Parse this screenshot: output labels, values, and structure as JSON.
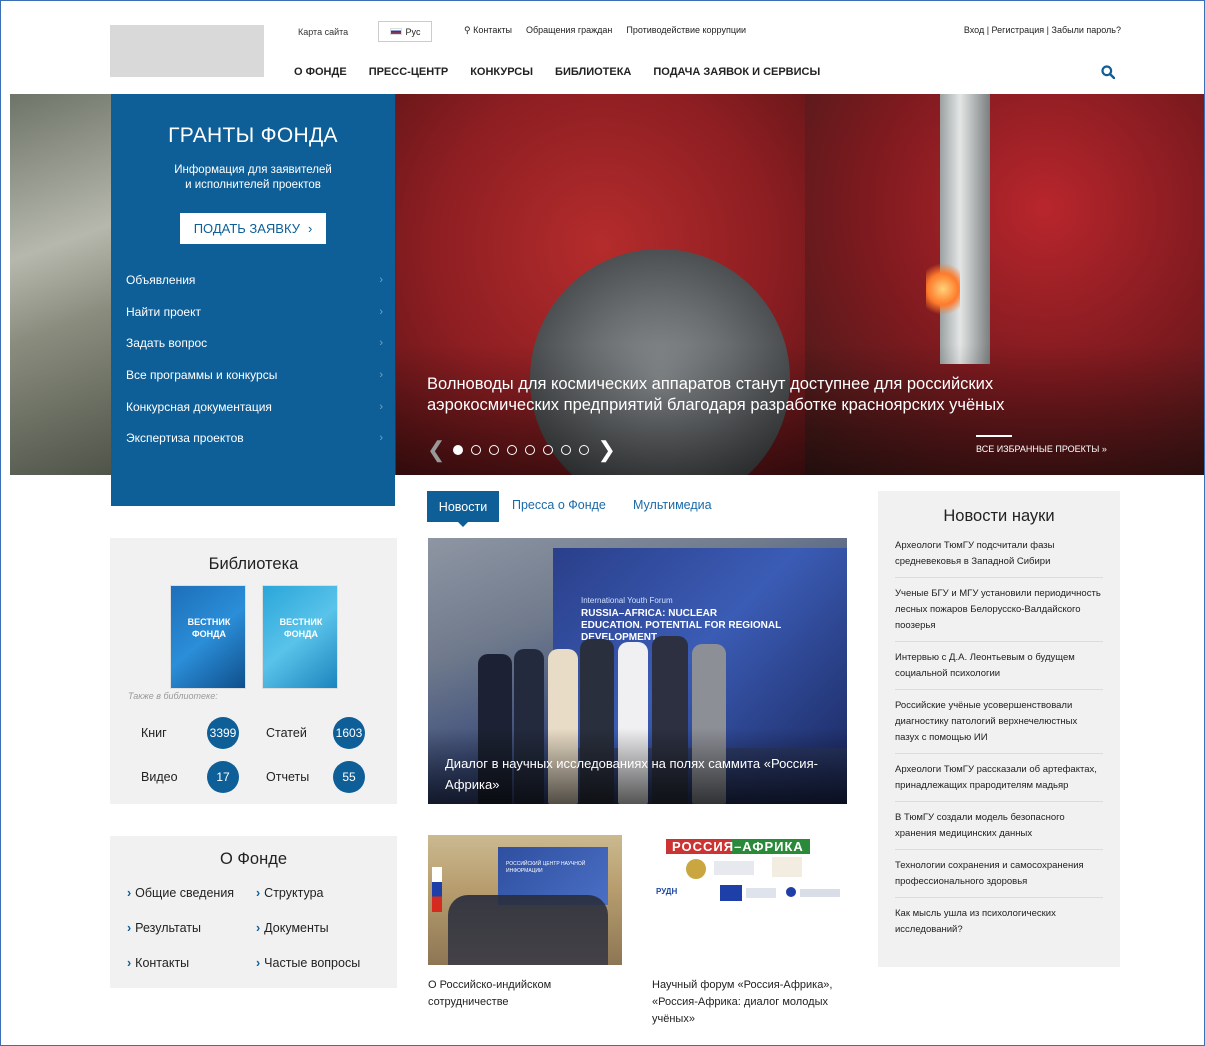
{
  "header": {
    "site_map": "Карта сайта",
    "lang": "Рус",
    "contacts": "Контакты",
    "appeals": "Обращения граждан",
    "anticorruption": "Противодействие коррупции",
    "auth": "Вход | Регистрация | Забыли пароль?",
    "nav": [
      "О ФОНДЕ",
      "ПРЕСС-ЦЕНТР",
      "КОНКУРСЫ",
      "БИБЛИОТЕКА",
      "ПОДАЧА ЗАЯВОК И СЕРВИСЫ"
    ]
  },
  "grants": {
    "title": "ГРАНТЫ ФОНДА",
    "subtitle_1": "Информация для заявителей",
    "subtitle_2": "и исполнителей проектов",
    "apply": "ПОДАТЬ ЗАЯВКУ",
    "menu": [
      "Объявления",
      "Найти проект",
      "Задать вопрос",
      "Все программы и конкурсы",
      "Конкурсная документация",
      "Экспертиза проектов"
    ]
  },
  "hero": {
    "title": "Волноводы для космических аппаратов станут доступнее для российских аэрокосмических предприятий благодаря разработке красноярских учёных",
    "all_projects": "ВСЕ ИЗБРАННЫЕ ПРОЕКТЫ »",
    "slides_total": 8,
    "active_slide": 1
  },
  "library": {
    "title": "Библиотека",
    "cover_1": "ВЕСТНИК ФОНДА",
    "cover_2": "ВЕСТНИК ФОНДА",
    "also": "Также в библиотеке:",
    "books_label": "Книг",
    "books": "3399",
    "articles_label": "Статей",
    "articles": "1603",
    "video_label": "Видео",
    "video": "17",
    "reports_label": "Отчеты",
    "reports": "55"
  },
  "about": {
    "title": "О Фонде",
    "links": [
      "Общие сведения",
      "Структура",
      "Результаты",
      "Документы",
      "Контакты",
      "Частые вопросы"
    ]
  },
  "tabs": [
    "Новости",
    "Пресса о Фонде",
    "Мультимедиа"
  ],
  "main_news": {
    "banner_small": "International Youth Forum",
    "banner_big": "RUSSIA–AFRICA: NUCLEAR EDUCATION. POTENTIAL FOR REGIONAL DEVELOPMENT",
    "caption": "Диалог в научных исследованиях на полях саммита «Россия-Африка»"
  },
  "small_news": [
    {
      "caption": "О Российско-индийском сотрудничестве",
      "screen": "РОССИЙСКИЙ ЦЕНТР НАУЧНОЙ ИНФОРМАЦИИ"
    },
    {
      "caption": "Научный форум «Россия-Африка», «Россия-Африка: диалог молодых учёных»",
      "banner": "РОССИЯ–АФРИКА",
      "logo_text": "РУДН"
    }
  ],
  "science": {
    "title": "Новости науки",
    "items": [
      "Археологи ТюмГУ подсчитали фазы средневековья в Западной Сибири",
      "Ученые БГУ и МГУ установили периодичность лесных пожаров Белорусско-Валдайского поозерья",
      "Интервью с Д.А. Леонтьевым о будущем социальной психологии",
      "Российские учёные усовершенствовали диагностику патологий верхнечелюстных пазух с помощью ИИ",
      "Археологи ТюмГУ рассказали об артефактах, принадлежащих прародителям мадьяр",
      "В ТюмГУ создали модель безопасного хранения медицинских данных",
      "Технологии сохранения и самосохранения профессионального здоровья",
      "Как мысль ушла из психологических исследований?"
    ]
  },
  "colors": {
    "accent": "#0e5f97",
    "panel": "#f1f1f1"
  }
}
